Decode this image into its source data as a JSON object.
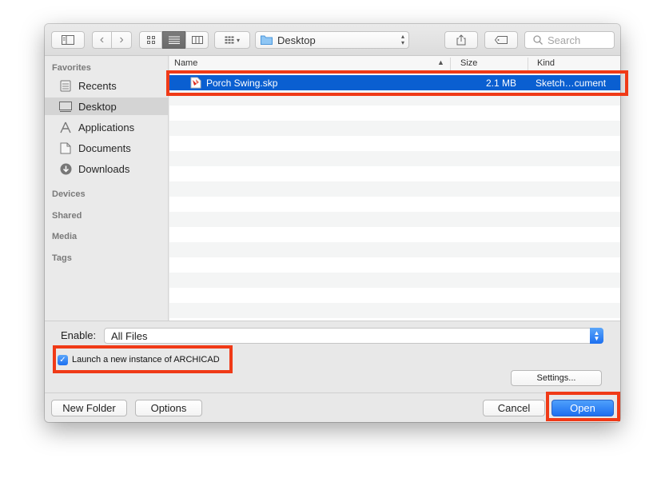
{
  "toolbar": {
    "location": "Desktop",
    "search_placeholder": "Search"
  },
  "sidebar": {
    "favorites_label": "Favorites",
    "favorites": [
      {
        "label": "Recents",
        "icon": "recents-icon"
      },
      {
        "label": "Desktop",
        "icon": "desktop-icon",
        "selected": true
      },
      {
        "label": "Applications",
        "icon": "applications-icon"
      },
      {
        "label": "Documents",
        "icon": "documents-icon"
      },
      {
        "label": "Downloads",
        "icon": "downloads-icon"
      }
    ],
    "devices_label": "Devices",
    "shared_label": "Shared",
    "media_label": "Media",
    "tags_label": "Tags"
  },
  "list": {
    "columns": {
      "name": "Name",
      "size": "Size",
      "kind": "Kind"
    },
    "files": [
      {
        "name": "Porch Swing.skp",
        "size": "2.1 MB",
        "kind": "Sketch…cument",
        "selected": true
      }
    ]
  },
  "accessory": {
    "enable_label": "Enable:",
    "enable_value": "All Files",
    "checkbox_label": "Launch a new instance of ARCHICAD",
    "checkbox_checked": true,
    "settings_label": "Settings..."
  },
  "footer": {
    "new_folder_label": "New Folder",
    "options_label": "Options",
    "cancel_label": "Cancel",
    "open_label": "Open"
  },
  "colors": {
    "selection": "#0a5fd1",
    "highlight": "#f03a17",
    "primary_button": "#1c6ff0"
  }
}
